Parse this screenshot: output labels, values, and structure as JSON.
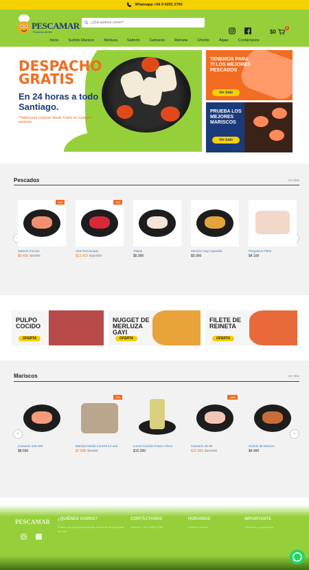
{
  "topbar": {
    "text": "Whatsapp +56 9 6291 2790"
  },
  "header": {
    "brand": "PESCAMAR",
    "tagline": "Productos del Mar",
    "search_placeholder": "¿Qué quieres comer?",
    "cart_total": "$0",
    "cart_count": "0"
  },
  "nav": [
    "Inicio",
    "Surtido Marisco",
    "Merluza",
    "Salmón",
    "Camarón",
    "Reineta",
    "Chorito",
    "Algas",
    "Contáctanos"
  ],
  "hero": {
    "title": "DESPACHO GRATIS",
    "subtitle": "En 24 horas a todo Santiago.",
    "note": "*Válido para compras desde 4 kilos en cualquier producto."
  },
  "side_banners": [
    {
      "text": "TENEMOS PARA TI LOS MEJORES PESCADOS",
      "button": "Ver todo"
    },
    {
      "text": "PRUEBA LOS MEJORES MARISCOS",
      "button": "Ver todo"
    }
  ],
  "pescados": {
    "title": "Pescados",
    "more": "Ver Más",
    "items": [
      {
        "name": "Salmón Porción",
        "price": "$9.400",
        "old": "$9.990",
        "discount": "-5%",
        "color": "#f09070"
      },
      {
        "name": "Atún Porcionado",
        "price": "$12.410",
        "old": "$12.990",
        "discount": "-4%",
        "color": "#d8283a"
      },
      {
        "name": "Tilapia",
        "price": "$6.990",
        "old": "",
        "discount": "",
        "color": "#f4e3d7"
      },
      {
        "name": "Merluza Gayi Apanada",
        "price": "$5.990",
        "old": "",
        "discount": "",
        "color": "#e6a33a"
      },
      {
        "name": "Pangasius Filete",
        "price": "$4.100",
        "old": "",
        "discount": "",
        "color": "#f1d8c8"
      }
    ]
  },
  "promos": [
    {
      "text": "PULPO COCIDO",
      "button": "OFERTA"
    },
    {
      "text": "NUGGET DE MERLUZA GAYI",
      "button": "OFERTA"
    },
    {
      "text": "FILETE DE REINETA",
      "button": "OFERTA"
    }
  ],
  "mariscos": {
    "title": "Mariscos",
    "more": "Ver Más",
    "items": [
      {
        "name": "Camarón 100-150",
        "price": "$8.590",
        "old": "",
        "discount": "",
        "color": "#f59b7a"
      },
      {
        "name": "Machas Media Concha 12 und.",
        "price": "$7.590",
        "old": "$8.390",
        "discount": "-9%",
        "color": "#b9a68d"
      },
      {
        "name": "Locos Cocidos Frasco Chico",
        "price": "$15.300",
        "old": "",
        "discount": "",
        "color": "#d9d180"
      },
      {
        "name": "Camarón 26-30",
        "price": "$12.900",
        "old": "$14.990",
        "discount": "-14%",
        "color": "#f2c6b6"
      },
      {
        "name": "Surtido de Marisco",
        "price": "$4.490",
        "old": "",
        "discount": "",
        "color": "#c86d3a"
      }
    ]
  },
  "footer": {
    "cols": [
      {
        "h": "¿QUIÉNES SOMOS?",
        "t": "Somos una empresa dedicada a la venta de productos del mar"
      },
      {
        "h": "CONTÁCTANOS",
        "t": "Teléfono: +56 9 6291 2790"
      },
      {
        "h": "HORARIOS",
        "t": "Lunes a Viernes"
      },
      {
        "h": "IMPORTANTE",
        "t": "Términos y condiciones"
      }
    ]
  },
  "colors": {
    "brand_green": "#95d03a",
    "accent_orange": "#f26d21",
    "accent_yellow": "#f5d000"
  }
}
